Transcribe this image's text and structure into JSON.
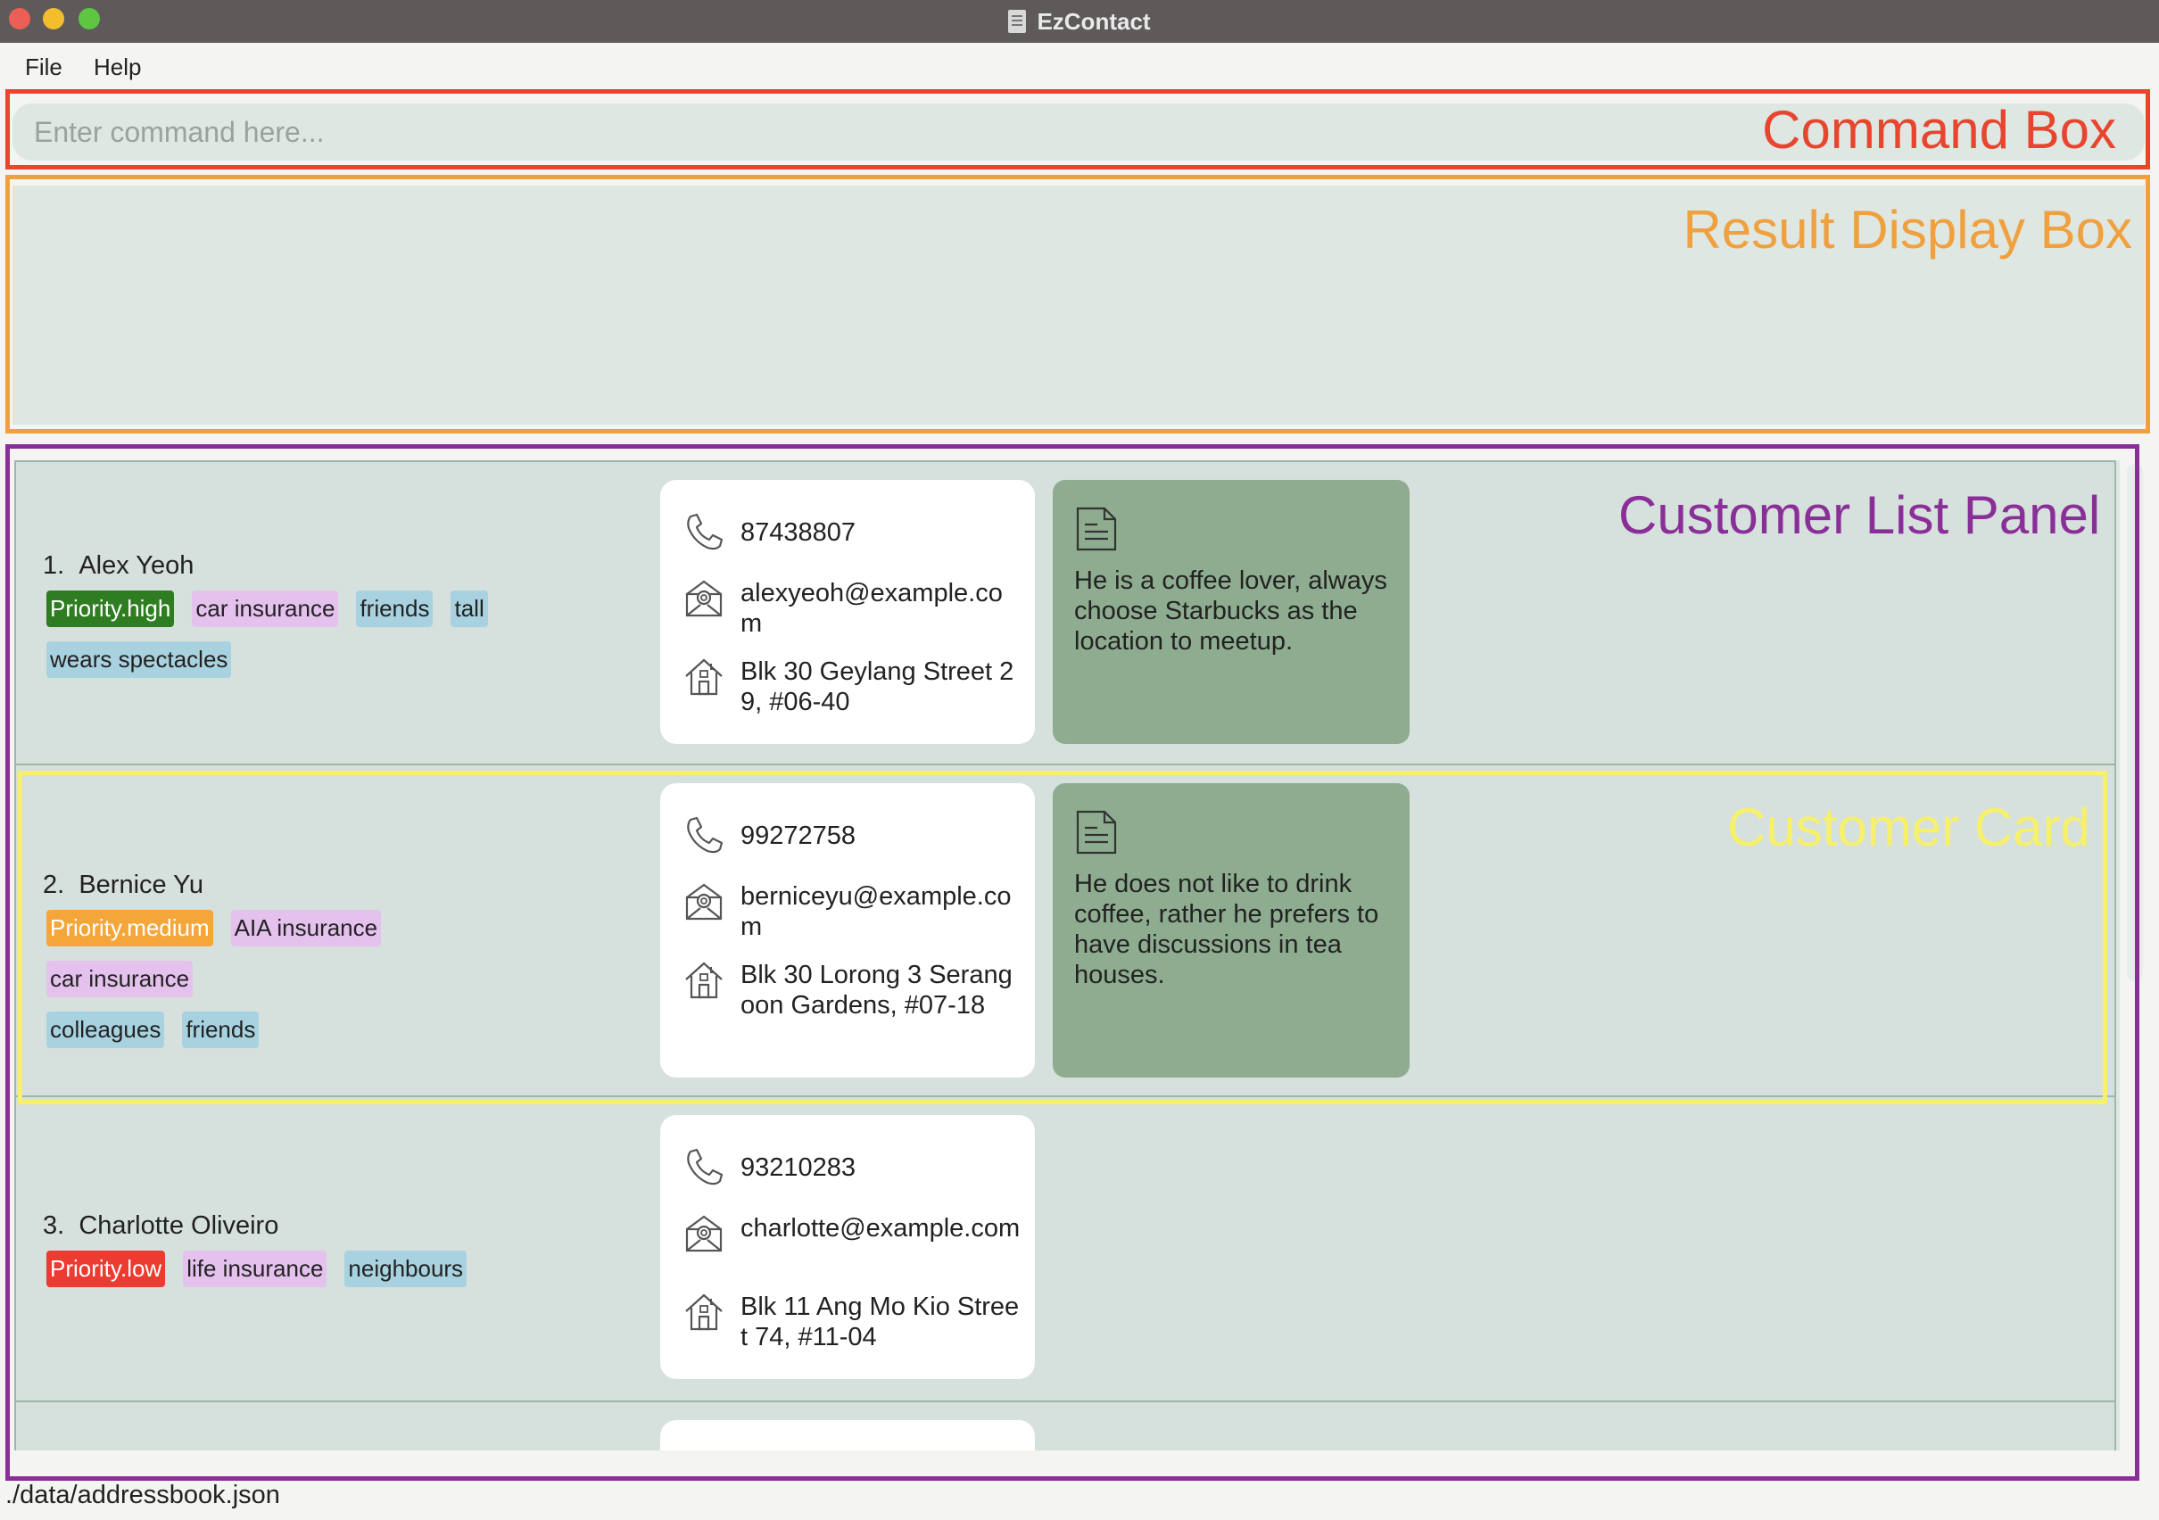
{
  "window": {
    "title": "EzContact"
  },
  "menu": {
    "file": "File",
    "help": "Help"
  },
  "command_box": {
    "placeholder": "Enter command here...",
    "annotation": "Command Box",
    "annotation_color": "#e8452f"
  },
  "result_box": {
    "annotation": "Result Display Box",
    "annotation_color": "#f0a13f"
  },
  "list_panel": {
    "annotation": "Customer List Panel",
    "annotation_color": "#8a2f98"
  },
  "customer_card": {
    "annotation": "Customer Card",
    "annotation_color": "#f7f06b"
  },
  "customers": [
    {
      "index": "1.",
      "name": "Alex Yeoh",
      "tags": [
        {
          "label": "Priority.high",
          "type": "priority",
          "color": "#2f7d21"
        },
        {
          "label": "car insurance",
          "type": "ins"
        },
        {
          "label": "friends",
          "type": "gen"
        },
        {
          "label": "tall",
          "type": "gen"
        },
        {
          "label": "wears spectacles",
          "type": "gen"
        }
      ],
      "phone": "87438807",
      "email": "alexyeoh@example.com",
      "address": "Blk 30 Geylang Street 29, #06-40",
      "remark": "He is a coffee lover, always choose Starbucks as the location to meetup."
    },
    {
      "index": "2.",
      "name": "Bernice Yu",
      "tags": [
        {
          "label": "Priority.medium",
          "type": "priority",
          "color": "#f5a63a"
        },
        {
          "label": "AIA insurance",
          "type": "ins"
        },
        {
          "label": "car insurance",
          "type": "ins"
        },
        {
          "label": "colleagues",
          "type": "gen"
        },
        {
          "label": "friends",
          "type": "gen"
        }
      ],
      "phone": "99272758",
      "email": "berniceyu@example.com",
      "address": "Blk 30 Lorong 3 Serangoon Gardens, #07-18",
      "remark": "He does not like to drink coffee, rather he prefers to have discussions in tea houses."
    },
    {
      "index": "3.",
      "name": "Charlotte Oliveiro",
      "tags": [
        {
          "label": "Priority.low",
          "type": "priority",
          "color": "#ec3b30"
        },
        {
          "label": "life insurance",
          "type": "ins"
        },
        {
          "label": "neighbours",
          "type": "gen"
        }
      ],
      "phone": "93210283",
      "email": "charlotte@example.com",
      "address": "Blk 11 Ang Mo Kio Street 74, #11-04",
      "remark": ""
    }
  ],
  "status_bar": {
    "path": "./data/addressbook.json"
  }
}
